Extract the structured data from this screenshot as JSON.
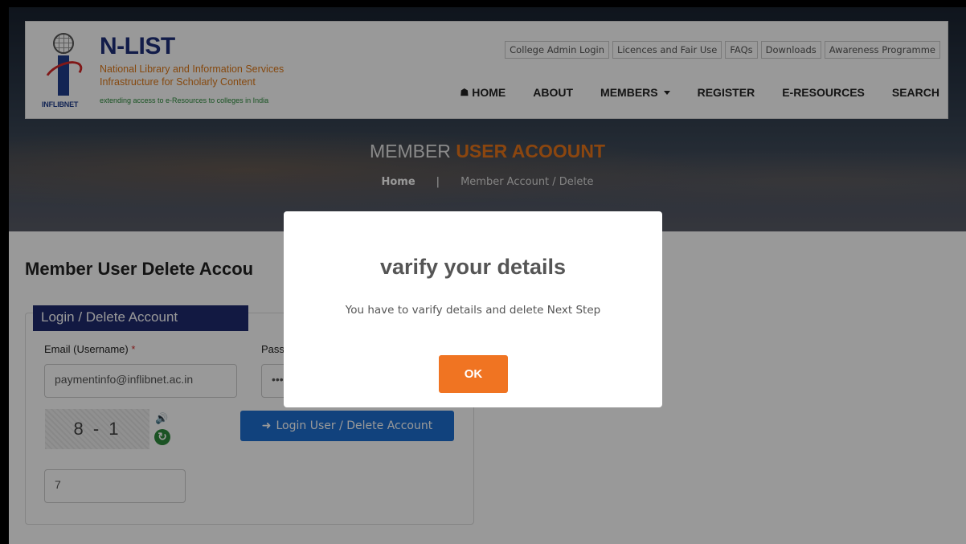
{
  "brand": {
    "title": "N-LIST",
    "subtitle_1": "National Library and Information Services",
    "subtitle_2": "Infrastructure for Scholarly Content",
    "tagline": "extending access to e-Resources to colleges in India",
    "logo_text": "INFLIBNET"
  },
  "toplinks": [
    "College Admin Login",
    "Licences and Fair Use",
    "FAQs",
    "Downloads",
    "Awareness Programme"
  ],
  "nav": {
    "home": "HOME",
    "about": "ABOUT",
    "members": "MEMBERS",
    "register": "REGISTER",
    "eresources": "E-RESOURCES",
    "search": "SEARCH"
  },
  "page": {
    "heading_plain": "MEMBER",
    "heading_accent": "USER ACOOUNT",
    "breadcrumb_home": "Home",
    "breadcrumb_sep": "|",
    "breadcrumb_current": "Member Account / Delete"
  },
  "content": {
    "title": "Member User Delete Accou",
    "panel_tab": "Login / Delete Account",
    "email_label": "Email (Username)",
    "required_mark": "*",
    "password_label": "Passw",
    "email_value": "paymentinfo@inflibnet.ac.in",
    "password_value": "•••",
    "captcha_text": "8 - 1",
    "captcha_answer": "7",
    "login_button": "Login User / Delete Account"
  },
  "modal": {
    "title": "varify your details",
    "message": "You have to varify details and delete Next Step",
    "ok_button": "OK"
  },
  "colors": {
    "accent_orange": "#e8751a",
    "ok_button": "#f07422",
    "login_button": "#1d6fd0",
    "panel_tab": "#1e2a6e",
    "brand_blue": "#1f2f7a"
  }
}
